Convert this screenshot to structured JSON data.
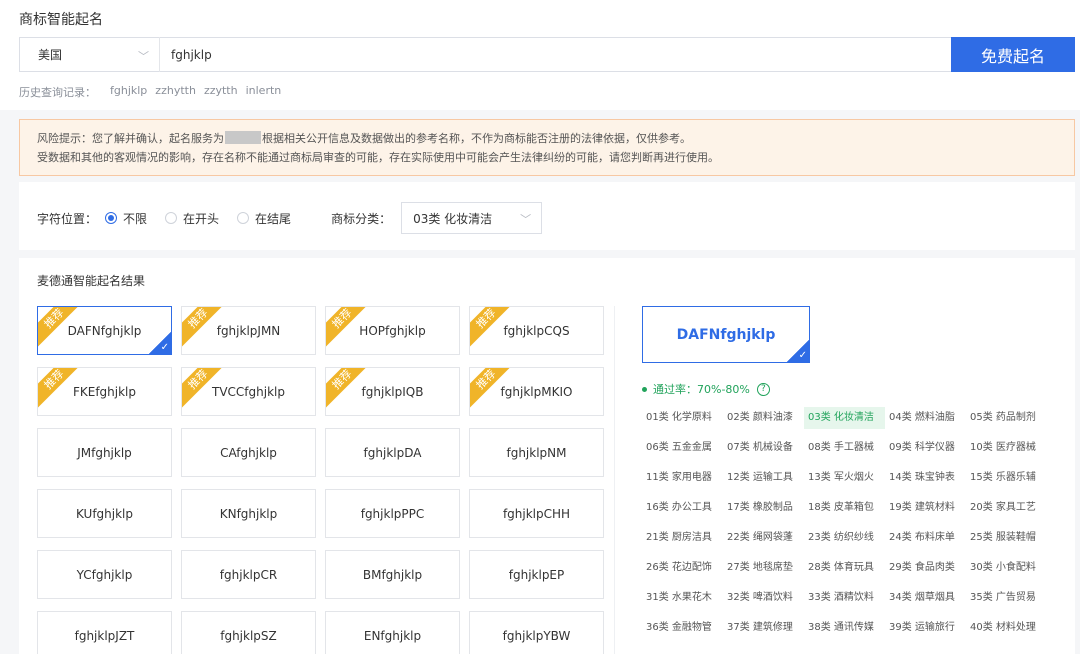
{
  "header": {
    "title": "商标智能起名",
    "country": "美国",
    "query": "fghjklp",
    "submit_label": "免费起名",
    "history_label": "历史查询记录：",
    "history": [
      "fghjklp",
      "zzhytth",
      "zzytth",
      "inlertn"
    ]
  },
  "warning": {
    "line1_a": "风险提示：您了解并确认，起名服务为",
    "line1_b": "根据相关公开信息及数据做出的参考名称，不作为商标能否注册的法律依据，仅供参考。",
    "line2": "受数据和其他的客观情况的影响，存在名称不能通过商标局审查的可能，存在实际使用中可能会产生法律纠纷的可能，请您判断再进行使用。"
  },
  "filters": {
    "position_label": "字符位置：",
    "options": [
      "不限",
      "在开头",
      "在结尾"
    ],
    "selected_index": 0,
    "category_label": "商标分类：",
    "category_value": "03类 化妆清洁"
  },
  "results": {
    "title": "麦德通智能起名结果",
    "ribbon_label": "推荐",
    "names": [
      {
        "name": "DAFNfghjklp",
        "recommended": true,
        "selected": true
      },
      {
        "name": "fghjklpJMN",
        "recommended": true,
        "selected": false
      },
      {
        "name": "HOPfghjklp",
        "recommended": true,
        "selected": false
      },
      {
        "name": "fghjklpCQS",
        "recommended": true,
        "selected": false
      },
      {
        "name": "FKEfghjklp",
        "recommended": true,
        "selected": false
      },
      {
        "name": "TVCCfghjklp",
        "recommended": true,
        "selected": false
      },
      {
        "name": "fghjklpIQB",
        "recommended": true,
        "selected": false
      },
      {
        "name": "fghjklpMKIO",
        "recommended": true,
        "selected": false
      },
      {
        "name": "JMfghjklp",
        "recommended": false,
        "selected": false
      },
      {
        "name": "CAfghjklp",
        "recommended": false,
        "selected": false
      },
      {
        "name": "fghjklpDA",
        "recommended": false,
        "selected": false
      },
      {
        "name": "fghjklpNM",
        "recommended": false,
        "selected": false
      },
      {
        "name": "KUfghjklp",
        "recommended": false,
        "selected": false
      },
      {
        "name": "KNfghjklp",
        "recommended": false,
        "selected": false
      },
      {
        "name": "fghjklpPPC",
        "recommended": false,
        "selected": false
      },
      {
        "name": "fghjklpCHH",
        "recommended": false,
        "selected": false
      },
      {
        "name": "YCfghjklp",
        "recommended": false,
        "selected": false
      },
      {
        "name": "fghjklpCR",
        "recommended": false,
        "selected": false
      },
      {
        "name": "BMfghjklp",
        "recommended": false,
        "selected": false
      },
      {
        "name": "fghjklpEP",
        "recommended": false,
        "selected": false
      },
      {
        "name": "fghjklpJZT",
        "recommended": false,
        "selected": false
      },
      {
        "name": "fghjklpSZ",
        "recommended": false,
        "selected": false
      },
      {
        "name": "ENfghjklp",
        "recommended": false,
        "selected": false
      },
      {
        "name": "fghjklpYBW",
        "recommended": false,
        "selected": false
      }
    ]
  },
  "detail": {
    "name": "DAFNfghjklp",
    "pass_rate": "通过率：70%-80%",
    "help": "?",
    "active_class_index": 2,
    "classes": [
      "01类 化学原料",
      "02类 颜料油漆",
      "03类 化妆清洁",
      "04类 燃料油脂",
      "05类 药品制剂",
      "06类 五金金属",
      "07类 机械设备",
      "08类 手工器械",
      "09类 科学仪器",
      "10类 医疗器械",
      "11类 家用电器",
      "12类 运输工具",
      "13类 军火烟火",
      "14类 珠宝钟表",
      "15类 乐器乐辅",
      "16类 办公工具",
      "17类 橡胶制品",
      "18类 皮革箱包",
      "19类 建筑材料",
      "20类 家具工艺",
      "21类 厨房洁具",
      "22类 绳网袋蓬",
      "23类 纺织纱线",
      "24类 布料床单",
      "25类 服装鞋帽",
      "26类 花边配饰",
      "27类 地毯席垫",
      "28类 体育玩具",
      "29类 食品肉类",
      "30类 小食配料",
      "31类 水果花木",
      "32类 啤酒饮料",
      "33类 酒精饮料",
      "34类 烟草烟具",
      "35类 广告贸易",
      "36类 金融物管",
      "37类 建筑修理",
      "38类 通讯传媒",
      "39类 运输旅行",
      "40类 材料处理"
    ]
  },
  "colors": {
    "accent": "#2f6ce5",
    "ribbon": "#f0b429",
    "pass": "#21a35b",
    "warning_bg": "#fdf3e8"
  }
}
